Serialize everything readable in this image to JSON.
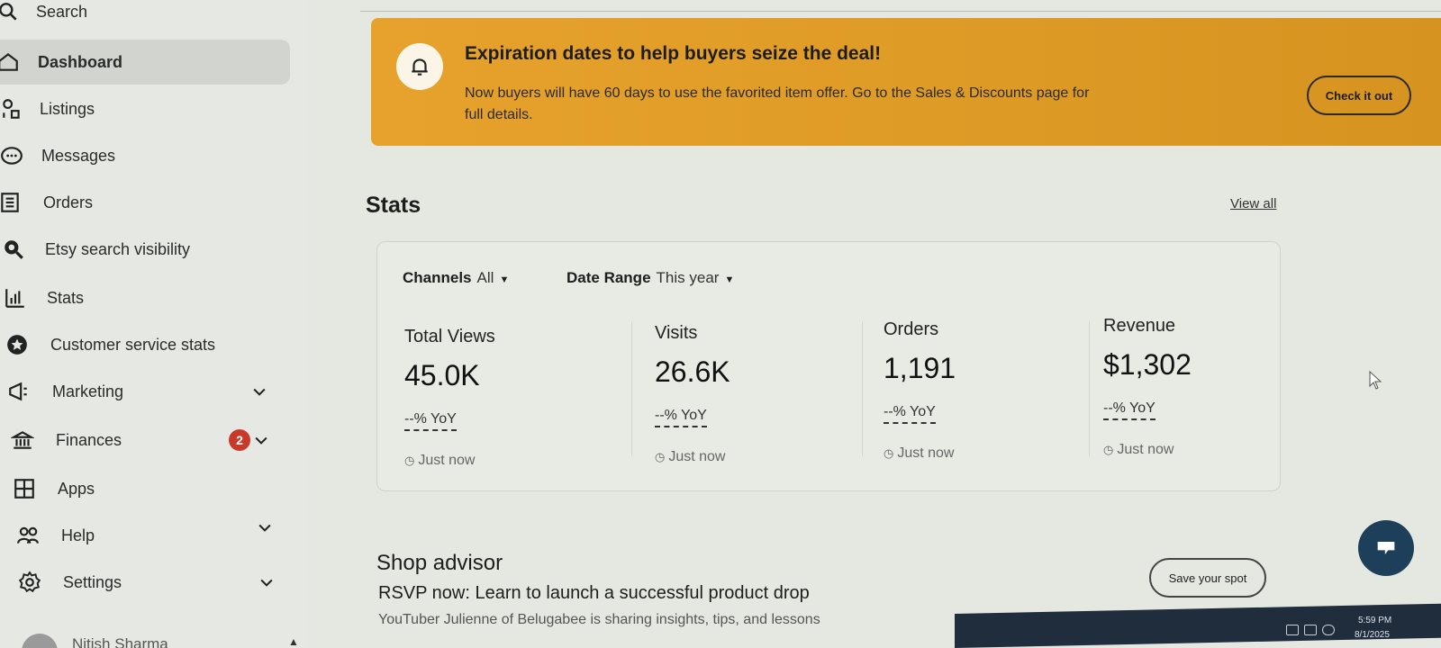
{
  "sidebar": {
    "search_label": "Search",
    "items": [
      {
        "label": "Dashboard",
        "icon": "home-icon",
        "active": true
      },
      {
        "label": "Listings",
        "icon": "listings-icon"
      },
      {
        "label": "Messages",
        "icon": "messages-icon"
      },
      {
        "label": "Orders",
        "icon": "orders-icon"
      },
      {
        "label": "Etsy search visibility",
        "icon": "search-visibility-icon"
      },
      {
        "label": "Stats",
        "icon": "stats-icon"
      },
      {
        "label": "Customer service stats",
        "icon": "customer-service-icon"
      },
      {
        "label": "Marketing",
        "icon": "megaphone-icon",
        "expandable": true
      },
      {
        "label": "Finances",
        "icon": "bank-icon",
        "expandable": true,
        "badge": "2"
      },
      {
        "label": "Apps",
        "icon": "apps-icon"
      },
      {
        "label": "Help",
        "icon": "help-icon",
        "expandable": true
      },
      {
        "label": "Settings",
        "icon": "gear-icon",
        "expandable": true
      }
    ],
    "user_name": "Nitish Sharma"
  },
  "banner": {
    "title": "Expiration dates to help buyers seize the deal!",
    "body": "Now buyers will have 60 days to use the favorited item offer. Go to the Sales & Discounts page for full details.",
    "button": "Check it out",
    "color": "#e6a22c"
  },
  "stats": {
    "title": "Stats",
    "view_all": "View all",
    "filters": {
      "channels_label": "Channels",
      "channels_value": "All",
      "date_label": "Date Range",
      "date_value": "This year"
    },
    "metrics": [
      {
        "label": "Total Views",
        "value": "45.0K",
        "yoy": "--% YoY",
        "updated": "Just now"
      },
      {
        "label": "Visits",
        "value": "26.6K",
        "yoy": "--% YoY",
        "updated": "Just now"
      },
      {
        "label": "Orders",
        "value": "1,191",
        "yoy": "--% YoY",
        "updated": "Just now"
      },
      {
        "label": "Revenue",
        "value": "$1,302",
        "yoy": "--% YoY",
        "updated": "Just now"
      }
    ]
  },
  "advisor": {
    "title": "Shop advisor",
    "headline": "RSVP now: Learn to launch a successful product drop",
    "sub": "YouTuber Julienne of Belugabee is sharing insights, tips, and lessons",
    "button": "Save your spot"
  },
  "taskbar": {
    "time": "5:59 PM",
    "date": "8/1/2025"
  }
}
